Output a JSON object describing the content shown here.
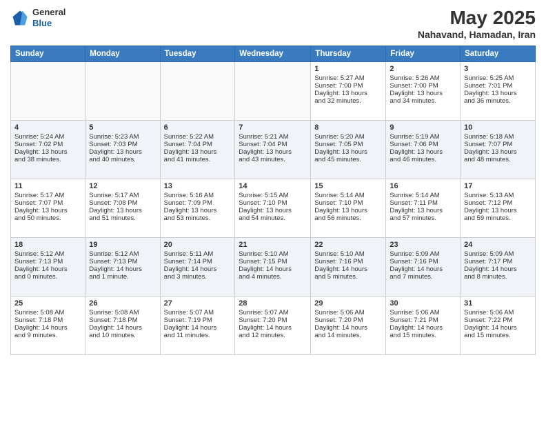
{
  "header": {
    "logo_general": "General",
    "logo_blue": "Blue",
    "month_year": "May 2025",
    "location": "Nahavand, Hamadan, Iran"
  },
  "weekdays": [
    "Sunday",
    "Monday",
    "Tuesday",
    "Wednesday",
    "Thursday",
    "Friday",
    "Saturday"
  ],
  "weeks": [
    [
      {
        "day": "",
        "content": ""
      },
      {
        "day": "",
        "content": ""
      },
      {
        "day": "",
        "content": ""
      },
      {
        "day": "",
        "content": ""
      },
      {
        "day": "1",
        "content": "Sunrise: 5:27 AM\nSunset: 7:00 PM\nDaylight: 13 hours\nand 32 minutes."
      },
      {
        "day": "2",
        "content": "Sunrise: 5:26 AM\nSunset: 7:00 PM\nDaylight: 13 hours\nand 34 minutes."
      },
      {
        "day": "3",
        "content": "Sunrise: 5:25 AM\nSunset: 7:01 PM\nDaylight: 13 hours\nand 36 minutes."
      }
    ],
    [
      {
        "day": "4",
        "content": "Sunrise: 5:24 AM\nSunset: 7:02 PM\nDaylight: 13 hours\nand 38 minutes."
      },
      {
        "day": "5",
        "content": "Sunrise: 5:23 AM\nSunset: 7:03 PM\nDaylight: 13 hours\nand 40 minutes."
      },
      {
        "day": "6",
        "content": "Sunrise: 5:22 AM\nSunset: 7:04 PM\nDaylight: 13 hours\nand 41 minutes."
      },
      {
        "day": "7",
        "content": "Sunrise: 5:21 AM\nSunset: 7:04 PM\nDaylight: 13 hours\nand 43 minutes."
      },
      {
        "day": "8",
        "content": "Sunrise: 5:20 AM\nSunset: 7:05 PM\nDaylight: 13 hours\nand 45 minutes."
      },
      {
        "day": "9",
        "content": "Sunrise: 5:19 AM\nSunset: 7:06 PM\nDaylight: 13 hours\nand 46 minutes."
      },
      {
        "day": "10",
        "content": "Sunrise: 5:18 AM\nSunset: 7:07 PM\nDaylight: 13 hours\nand 48 minutes."
      }
    ],
    [
      {
        "day": "11",
        "content": "Sunrise: 5:17 AM\nSunset: 7:07 PM\nDaylight: 13 hours\nand 50 minutes."
      },
      {
        "day": "12",
        "content": "Sunrise: 5:17 AM\nSunset: 7:08 PM\nDaylight: 13 hours\nand 51 minutes."
      },
      {
        "day": "13",
        "content": "Sunrise: 5:16 AM\nSunset: 7:09 PM\nDaylight: 13 hours\nand 53 minutes."
      },
      {
        "day": "14",
        "content": "Sunrise: 5:15 AM\nSunset: 7:10 PM\nDaylight: 13 hours\nand 54 minutes."
      },
      {
        "day": "15",
        "content": "Sunrise: 5:14 AM\nSunset: 7:10 PM\nDaylight: 13 hours\nand 56 minutes."
      },
      {
        "day": "16",
        "content": "Sunrise: 5:14 AM\nSunset: 7:11 PM\nDaylight: 13 hours\nand 57 minutes."
      },
      {
        "day": "17",
        "content": "Sunrise: 5:13 AM\nSunset: 7:12 PM\nDaylight: 13 hours\nand 59 minutes."
      }
    ],
    [
      {
        "day": "18",
        "content": "Sunrise: 5:12 AM\nSunset: 7:13 PM\nDaylight: 14 hours\nand 0 minutes."
      },
      {
        "day": "19",
        "content": "Sunrise: 5:12 AM\nSunset: 7:13 PM\nDaylight: 14 hours\nand 1 minute."
      },
      {
        "day": "20",
        "content": "Sunrise: 5:11 AM\nSunset: 7:14 PM\nDaylight: 14 hours\nand 3 minutes."
      },
      {
        "day": "21",
        "content": "Sunrise: 5:10 AM\nSunset: 7:15 PM\nDaylight: 14 hours\nand 4 minutes."
      },
      {
        "day": "22",
        "content": "Sunrise: 5:10 AM\nSunset: 7:16 PM\nDaylight: 14 hours\nand 5 minutes."
      },
      {
        "day": "23",
        "content": "Sunrise: 5:09 AM\nSunset: 7:16 PM\nDaylight: 14 hours\nand 7 minutes."
      },
      {
        "day": "24",
        "content": "Sunrise: 5:09 AM\nSunset: 7:17 PM\nDaylight: 14 hours\nand 8 minutes."
      }
    ],
    [
      {
        "day": "25",
        "content": "Sunrise: 5:08 AM\nSunset: 7:18 PM\nDaylight: 14 hours\nand 9 minutes."
      },
      {
        "day": "26",
        "content": "Sunrise: 5:08 AM\nSunset: 7:18 PM\nDaylight: 14 hours\nand 10 minutes."
      },
      {
        "day": "27",
        "content": "Sunrise: 5:07 AM\nSunset: 7:19 PM\nDaylight: 14 hours\nand 11 minutes."
      },
      {
        "day": "28",
        "content": "Sunrise: 5:07 AM\nSunset: 7:20 PM\nDaylight: 14 hours\nand 12 minutes."
      },
      {
        "day": "29",
        "content": "Sunrise: 5:06 AM\nSunset: 7:20 PM\nDaylight: 14 hours\nand 14 minutes."
      },
      {
        "day": "30",
        "content": "Sunrise: 5:06 AM\nSunset: 7:21 PM\nDaylight: 14 hours\nand 15 minutes."
      },
      {
        "day": "31",
        "content": "Sunrise: 5:06 AM\nSunset: 7:22 PM\nDaylight: 14 hours\nand 15 minutes."
      }
    ]
  ]
}
